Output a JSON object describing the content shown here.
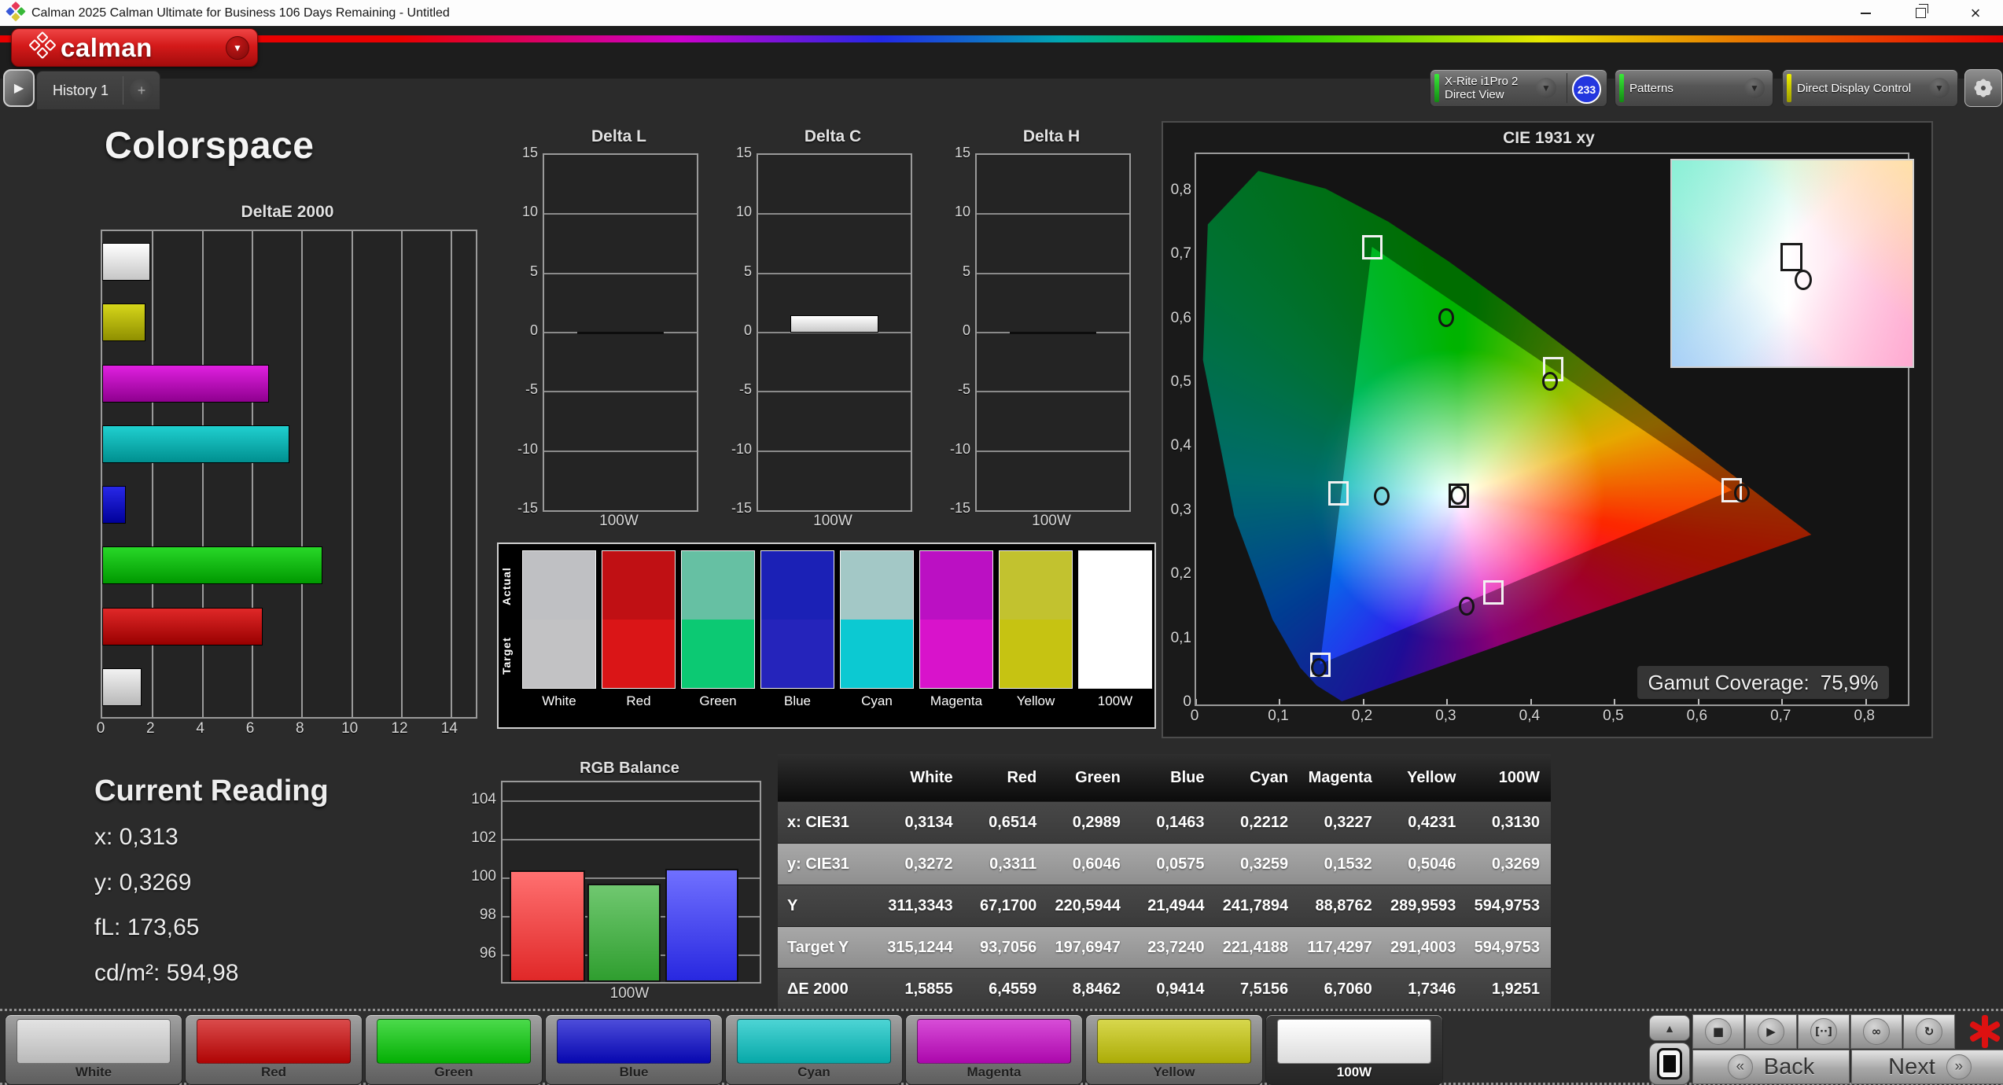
{
  "window": {
    "title": "Calman 2025 Calman Ultimate for Business 106 Days Remaining  - Untitled"
  },
  "brand": {
    "logo_text": "calman"
  },
  "tabs": {
    "history": "History 1",
    "add": "+"
  },
  "toolbar": {
    "meter_line1": "X-Rite i1Pro 2",
    "meter_line2": "Direct View",
    "meter_badge": "233",
    "patterns_label": "Patterns",
    "ddc_label": "Direct Display Control"
  },
  "page": {
    "title": "Colorspace"
  },
  "current_reading": {
    "title": "Current Reading",
    "lines": [
      {
        "label": "x:",
        "value": "0,313"
      },
      {
        "label": "y:",
        "value": "0,3269"
      },
      {
        "label": "fL:",
        "value": "173,65"
      },
      {
        "label": "cd/m²:",
        "value": "594,98"
      }
    ]
  },
  "swatch_strip": {
    "actual_label": "Actual",
    "target_label": "Target",
    "columns": [
      {
        "label": "White",
        "actual": "#bfc0c3",
        "target": "#c2c2c4"
      },
      {
        "label": "Red",
        "actual": "#c01014",
        "target": "#da1517"
      },
      {
        "label": "Green",
        "actual": "#66c0a3",
        "target": "#0cc973"
      },
      {
        "label": "Blue",
        "actual": "#1b21b6",
        "target": "#2524bb"
      },
      {
        "label": "Cyan",
        "actual": "#a3c8c6",
        "target": "#0cc9d2"
      },
      {
        "label": "Magenta",
        "actual": "#bb10c3",
        "target": "#d813cb"
      },
      {
        "label": "Yellow",
        "actual": "#c2c22f",
        "target": "#c6c312"
      },
      {
        "label": "100W",
        "actual": "#ffffff",
        "target": "#ffffff"
      }
    ]
  },
  "table": {
    "headers": [
      "",
      "White",
      "Red",
      "Green",
      "Blue",
      "Cyan",
      "Magenta",
      "Yellow",
      "100W"
    ],
    "rows": [
      {
        "label": "x: CIE31",
        "light": false,
        "values": [
          "0,3134",
          "0,6514",
          "0,2989",
          "0,1463",
          "0,2212",
          "0,3227",
          "0,4231",
          "0,3130"
        ]
      },
      {
        "label": "y: CIE31",
        "light": true,
        "values": [
          "0,3272",
          "0,3311",
          "0,6046",
          "0,0575",
          "0,3259",
          "0,1532",
          "0,5046",
          "0,3269"
        ]
      },
      {
        "label": "Y",
        "light": false,
        "values": [
          "311,3343",
          "67,1700",
          "220,5944",
          "21,4944",
          "241,7894",
          "88,8762",
          "289,9593",
          "594,9753"
        ]
      },
      {
        "label": "Target Y",
        "light": true,
        "values": [
          "315,1244",
          "93,7056",
          "197,6947",
          "23,7240",
          "221,4188",
          "117,4297",
          "291,4003",
          "594,9753"
        ]
      },
      {
        "label": "ΔE 2000",
        "light": false,
        "values": [
          "1,5855",
          "6,4559",
          "8,8462",
          "0,9414",
          "7,5156",
          "6,7060",
          "1,7346",
          "1,9251"
        ]
      }
    ]
  },
  "bottom_bar": {
    "back_label": "Back",
    "next_label": "Next",
    "buttons": [
      {
        "label": "White",
        "color": "#d8d8d8",
        "selected": false
      },
      {
        "label": "Red",
        "color": "#cc0505",
        "selected": false
      },
      {
        "label": "Green",
        "color": "#05cc05",
        "selected": false
      },
      {
        "label": "Blue",
        "color": "#0808cc",
        "selected": false
      },
      {
        "label": "Cyan",
        "color": "#08c4c4",
        "selected": false
      },
      {
        "label": "Magenta",
        "color": "#c808c8",
        "selected": false
      },
      {
        "label": "Yellow",
        "color": "#c8c808",
        "selected": false
      },
      {
        "label": "100W",
        "color": "#ffffff",
        "selected": true
      }
    ]
  },
  "chart_data": [
    {
      "id": "deltae2000",
      "type": "bar",
      "orientation": "horizontal",
      "title": "DeltaE 2000",
      "xlim": [
        0,
        15
      ],
      "x_ticks": [
        0,
        2,
        4,
        6,
        8,
        10,
        12,
        14
      ],
      "categories": [
        "100W",
        "Yellow",
        "Magenta",
        "Cyan",
        "Blue",
        "Green",
        "Red",
        "White"
      ],
      "values": [
        1.9251,
        1.7346,
        6.706,
        7.5156,
        0.9414,
        8.8462,
        6.4559,
        1.5855
      ],
      "bar_colors": [
        [
          "#ffffff",
          "#c6c6c6"
        ],
        [
          "#d6d61a",
          "#8f8f00"
        ],
        [
          "#e020e0",
          "#8f008f"
        ],
        [
          "#20d0d0",
          "#008f8f"
        ],
        [
          "#2828e8",
          "#000099"
        ],
        [
          "#28d828",
          "#009900"
        ],
        [
          "#e02828",
          "#990000"
        ],
        [
          "#f2f2f2",
          "#b8b8b8"
        ]
      ]
    },
    {
      "id": "delta_l",
      "type": "bar",
      "title": "Delta L",
      "ylim": [
        -15,
        15
      ],
      "y_ticks": [
        15,
        10,
        5,
        0,
        -5,
        -10,
        -15
      ],
      "categories": [
        "100W"
      ],
      "values": [
        0
      ],
      "xlabel": "100W"
    },
    {
      "id": "delta_c",
      "type": "bar",
      "title": "Delta C",
      "ylim": [
        -15,
        15
      ],
      "y_ticks": [
        15,
        10,
        5,
        0,
        -5,
        -10,
        -15
      ],
      "categories": [
        "100W"
      ],
      "values": [
        1.3
      ],
      "xlabel": "100W"
    },
    {
      "id": "delta_h",
      "type": "bar",
      "title": "Delta H",
      "ylim": [
        -15,
        15
      ],
      "y_ticks": [
        15,
        10,
        5,
        0,
        -5,
        -10,
        -15
      ],
      "categories": [
        "100W"
      ],
      "values": [
        0
      ],
      "xlabel": "100W"
    },
    {
      "id": "rgb_balance",
      "type": "bar",
      "title": "RGB Balance",
      "ylim": [
        94.6,
        105.0
      ],
      "y_ticks": [
        104,
        102,
        100,
        98,
        96
      ],
      "categories": [
        "Red",
        "Green",
        "Blue"
      ],
      "values": [
        100.4,
        99.7,
        100.5
      ],
      "xlabel": "100W",
      "bar_colors": [
        [
          "#ff7070",
          "#e02828"
        ],
        [
          "#70c870",
          "#2f9e2f"
        ],
        [
          "#7070ff",
          "#2828e0"
        ]
      ]
    },
    {
      "id": "cie1931",
      "type": "scatter",
      "title": "CIE 1931 xy",
      "xlim": [
        0,
        0.85
      ],
      "ylim": [
        0,
        0.86
      ],
      "x_ticks": [
        0,
        0.1,
        0.2,
        0.3,
        0.4,
        0.5,
        0.6,
        0.7,
        0.8
      ],
      "x_tick_labels": [
        "0",
        "0,1",
        "0,2",
        "0,3",
        "0,4",
        "0,5",
        "0,6",
        "0,7",
        "0,8"
      ],
      "y_ticks": [
        0.8,
        0.7,
        0.6,
        0.5,
        0.4,
        0.3,
        0.2,
        0.1,
        0
      ],
      "y_tick_labels": [
        "0,8",
        "0,7",
        "0,6",
        "0,5",
        "0,4",
        "0,3",
        "0,2",
        "0,1",
        "0"
      ],
      "coverage_label": "Gamut Coverage:",
      "coverage_value": "75,9%",
      "triangle": [
        [
          0.64,
          0.335
        ],
        [
          0.21,
          0.715
        ],
        [
          0.148,
          0.063
        ]
      ],
      "targets": [
        {
          "name": "white",
          "x": 0.3134,
          "y": 0.3272
        },
        {
          "name": "red",
          "x": 0.64,
          "y": 0.335
        },
        {
          "name": "green",
          "x": 0.21,
          "y": 0.715
        },
        {
          "name": "blue",
          "x": 0.148,
          "y": 0.063
        },
        {
          "name": "cyan",
          "x": 0.17,
          "y": 0.331
        },
        {
          "name": "magenta",
          "x": 0.355,
          "y": 0.176
        },
        {
          "name": "yellow",
          "x": 0.426,
          "y": 0.524
        }
      ],
      "measured": [
        {
          "name": "white",
          "x": 0.313,
          "y": 0.3269
        },
        {
          "name": "red",
          "x": 0.6514,
          "y": 0.3311
        },
        {
          "name": "green",
          "x": 0.2989,
          "y": 0.6046
        },
        {
          "name": "blue",
          "x": 0.1463,
          "y": 0.0575
        },
        {
          "name": "cyan",
          "x": 0.2212,
          "y": 0.3259
        },
        {
          "name": "magenta",
          "x": 0.3227,
          "y": 0.1532
        },
        {
          "name": "yellow",
          "x": 0.4231,
          "y": 0.5046
        }
      ]
    }
  ]
}
